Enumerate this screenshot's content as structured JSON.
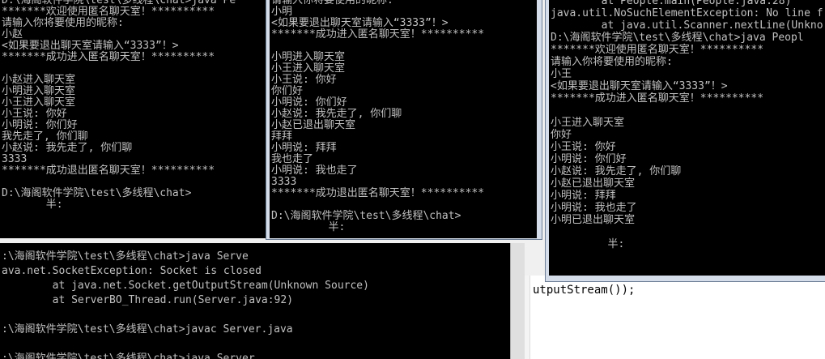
{
  "left_window": {
    "lines": [
      "D:\\海阁软件学院\\test\\多线程\\chat>java Pe",
      "*******欢迎使用匿名聊天室！**********",
      "请输入你将要使用的昵称:",
      "小赵",
      "<如果要退出聊天室请输入“3333”！>",
      "*******成功进入匿名聊天室！**********",
      "",
      "小赵进入聊天室",
      "小明进入聊天室",
      "小王进入聊天室",
      "小王说: 你好",
      "小明说: 你们好",
      "我先走了, 你们聊",
      "小赵说: 我先走了, 你们聊",
      "3333",
      "*******成功退出匿名聊天室！**********",
      "",
      "D:\\海阁软件学院\\test\\多线程\\chat>",
      "       半:"
    ]
  },
  "middle_window": {
    "lines": [
      "请输入你将要使用的昵称:",
      "小明",
      "<如果要退出聊天室请输入“3333”！>",
      "*******成功进入匿名聊天室！**********",
      "",
      "小明进入聊天室",
      "小王进入聊天室",
      "小王说: 你好",
      "你们好",
      "小明说: 你们好",
      "小赵说: 我先走了, 你们聊",
      "小赵已退出聊天室",
      "拜拜",
      "小明说: 拜拜",
      "我也走了",
      "小明说: 我也走了",
      "3333",
      "*******成功退出匿名聊天室！**********",
      "",
      "D:\\海阁软件学院\\test\\多线程\\chat>",
      "         半:"
    ]
  },
  "right_window": {
    "lines": [
      "        at People.main(People.java:28)",
      "java.util.NoSuchElementException: No line f",
      "        at java.util.Scanner.nextLine(Unkno",
      "D:\\海阁软件学院\\test\\多线程\\chat>java Peopl",
      "*******欢迎使用匿名聊天室！**********",
      "请输入你将要使用的昵称:",
      "小王",
      "<如果要退出聊天室请输入“3333”！>",
      "*******成功进入匿名聊天室！**********",
      "",
      "小王进入聊天室",
      "你好",
      "小王说: 你好",
      "小明说: 你们好",
      "小赵说: 我先走了, 你们聊",
      "小赵已退出聊天室",
      "小明说: 拜拜",
      "小明说: 我也走了",
      "小明已退出聊天室",
      "",
      "         半:"
    ]
  },
  "bottom_window": {
    "lines": [
      ":\\海阁软件学院\\test\\多线程\\chat>java Serve",
      "ava.net.SocketException: Socket is closed",
      "        at java.net.Socket.getOutputStream(Unknown Source)",
      "        at ServerBO_Thread.run(Server.java:92)",
      "",
      ":\\海阁软件学院\\test\\多线程\\chat>javac Server.java",
      "",
      ":\\海阁软件学院\\test\\多线程\\chat>java Server"
    ]
  },
  "editor": {
    "code": "utputStream());"
  }
}
